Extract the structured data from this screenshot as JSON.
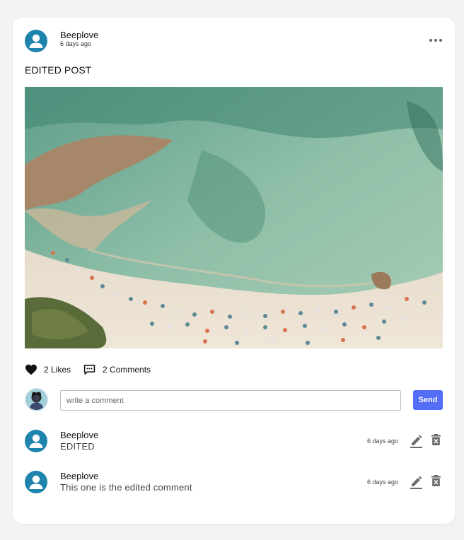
{
  "post": {
    "author": "Beeplove",
    "time": "6 days ago",
    "text": "EDITED POST",
    "likes_label": "2 Likes",
    "comments_label": "2 Comments"
  },
  "composer": {
    "placeholder": "write a comment",
    "send_label": "Send"
  },
  "comments": [
    {
      "author": "Beeplove",
      "text": "EDITED",
      "time": "6 days ago"
    },
    {
      "author": "Beeplove",
      "text": "This one is the edited comment",
      "time": "6 days ago"
    }
  ],
  "icons": {
    "avatar": "person-icon",
    "menu": "more-horizontal-icon",
    "like": "heart-icon",
    "comment": "comment-icon",
    "edit": "pencil-icon",
    "delete": "trash-icon"
  },
  "colors": {
    "avatar_bg": "#1e84ae",
    "send_button": "#556ef7",
    "page_bg": "#f3f3f3"
  }
}
